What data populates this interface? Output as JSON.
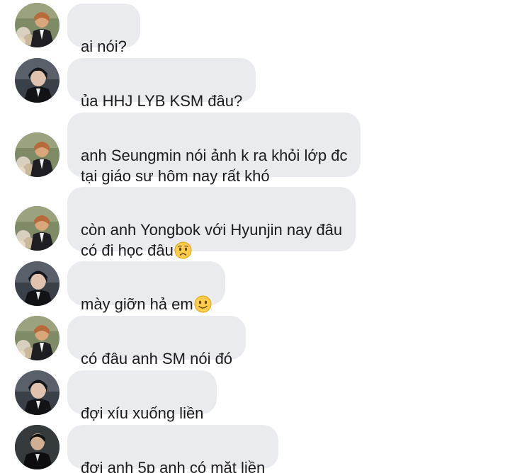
{
  "messages": [
    {
      "sender": "a",
      "text": "ai nói?"
    },
    {
      "sender": "b",
      "text": "ủa HHJ LYB KSM đâu?"
    },
    {
      "sender": "a",
      "text": "anh Seungmin nói ảnh k ra khỏi lớp đc\ntại giáo sư hôm nay rất khó"
    },
    {
      "sender": "a",
      "text": "còn anh Yongbok với Hyunjin nay đâu\ncó đi học đâu",
      "emoji": "worried-face-icon"
    },
    {
      "sender": "b",
      "text": "mày giỡn hả em",
      "emoji": "slightly-smiling-face-icon"
    },
    {
      "sender": "a",
      "text": "có đâu anh SM nói đó"
    },
    {
      "sender": "b",
      "text": "đợi xíu xuống liền"
    },
    {
      "sender": "c",
      "text": "đợi anh 5p anh có mặt liền"
    }
  ]
}
